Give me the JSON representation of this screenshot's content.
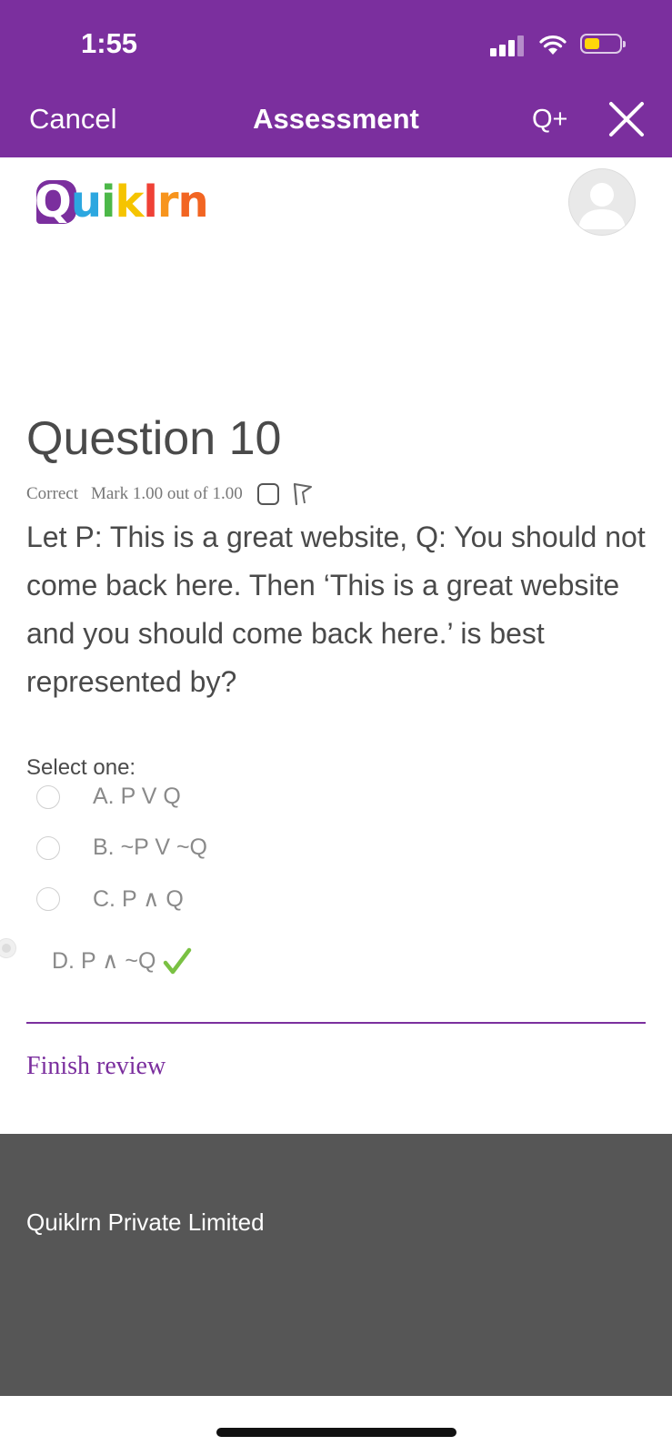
{
  "status_bar": {
    "time": "1:55"
  },
  "nav": {
    "cancel": "Cancel",
    "title": "Assessment",
    "qplus": "Q+"
  },
  "brand": {
    "logo_text": "Quiklrn",
    "accent": "#7b2f9e"
  },
  "question": {
    "title": "Question 10",
    "state": "Correct",
    "mark": "Mark 1.00 out of 1.00",
    "text": "Let P: This is a great website, Q: You should not come back here. Then ‘This is a great website and you should come back here.’ is best represented by?",
    "prompt": "Select one:",
    "options": [
      {
        "label": "A. P V Q"
      },
      {
        "label": "B. ~P V ~Q"
      },
      {
        "label": "C. P ∧ Q"
      },
      {
        "label": "D. P ∧ ~Q"
      }
    ],
    "selected": "D"
  },
  "actions": {
    "finish_review": "Finish review"
  },
  "footer": {
    "company": "Quiklrn Private Limited"
  }
}
